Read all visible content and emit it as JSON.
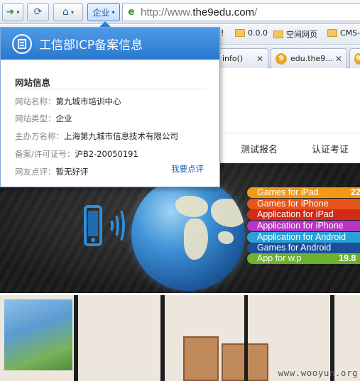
{
  "toolbar": {
    "corp_button_label": "企业",
    "url_prefix": "http://www.",
    "url_domain": "the9edu.com",
    "url_suffix": "/"
  },
  "bookmarks": [
    {
      "label": "0.0.0"
    },
    {
      "label": "空间网页"
    },
    {
      "label": "CMS-..."
    }
  ],
  "tabs": [
    {
      "label": "info()"
    },
    {
      "label": "edu.the9..."
    }
  ],
  "nav": {
    "items": [
      {
        "label": "测试报名"
      },
      {
        "label": "认证考证"
      }
    ]
  },
  "banner": {
    "app_list": [
      {
        "label": "Games for iPad",
        "color": "#f29a16",
        "number": "22"
      },
      {
        "label": "Games for iPhone",
        "color": "#e8551a"
      },
      {
        "label": "Application for iPad",
        "color": "#d42a18"
      },
      {
        "label": "Application for iPhone",
        "color": "#b935c2"
      },
      {
        "label": "Application for Android",
        "color": "#2aa2d6"
      },
      {
        "label": "Games for Android",
        "color": "#1c4f9a"
      },
      {
        "label": "App for w.p",
        "color": "#6db12f",
        "number": "19.8"
      }
    ]
  },
  "photo": {
    "watermark": "www.wooyun.org"
  },
  "popup": {
    "title": "工信部ICP备案信息",
    "section_title": "网站信息",
    "rows": [
      {
        "key": "网站名称：",
        "value": "第九城市培训中心"
      },
      {
        "key": "网站类型：",
        "value": "企业"
      },
      {
        "key": "主办方名称：",
        "value": "上海第九城市信息技术有限公司"
      },
      {
        "key": "备案/许可证号：",
        "value": "沪B2-20050191"
      },
      {
        "key": "网友点评：",
        "value": "暂无好评"
      }
    ],
    "review_link": "我要点评"
  },
  "colors": {
    "popup_header": "#2a78cf",
    "link": "#1e62b8",
    "banner_bg": "#1a1a1a"
  }
}
